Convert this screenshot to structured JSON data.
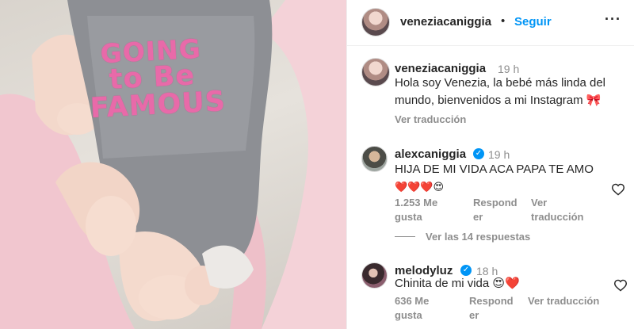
{
  "photo": {
    "shirt_print": [
      "GOING",
      "to Be",
      "FAMOUS"
    ]
  },
  "header": {
    "username": "veneziacaniggia",
    "separator": "•",
    "follow_label": "Seguir",
    "more_label": "···"
  },
  "caption": {
    "username": "veneziacaniggia",
    "time": "19 h",
    "text_line1": "Hola soy Venezia, la bebé más linda del",
    "text_line2": "mundo, bienvenidos a mi Instagram 🎀",
    "translate_label": "Ver traducción"
  },
  "comments": [
    {
      "username": "alexcaniggia",
      "verified": true,
      "time": "19 h",
      "text_line1": "HIJA DE MI VIDA ACA PAPA TE AMO",
      "text_line2": "❤️❤️❤️😍",
      "likes_line1": "1.253 Me",
      "likes_line2": "gusta",
      "reply_line1": "Respond",
      "reply_line2": "er",
      "translate_line1": "Ver",
      "translate_line2": "traducción",
      "view_replies": "Ver las 14 respuestas"
    },
    {
      "username": "melodyluz",
      "verified": true,
      "time": "18 h",
      "text_line1": "Chinita de mi vida 😍❤️",
      "likes_line1": "636 Me",
      "likes_line2": "gusta",
      "reply_line1": "Respond",
      "reply_line2": "er",
      "translate_line1": "Ver traducción"
    }
  ],
  "colors": {
    "link_blue": "#0095f6",
    "text": "#262626",
    "muted": "#8e8e8e",
    "print_pink": "#e86aa9"
  },
  "icons": [
    "verified-badge-icon",
    "heart-outline-icon",
    "more-options-icon"
  ]
}
